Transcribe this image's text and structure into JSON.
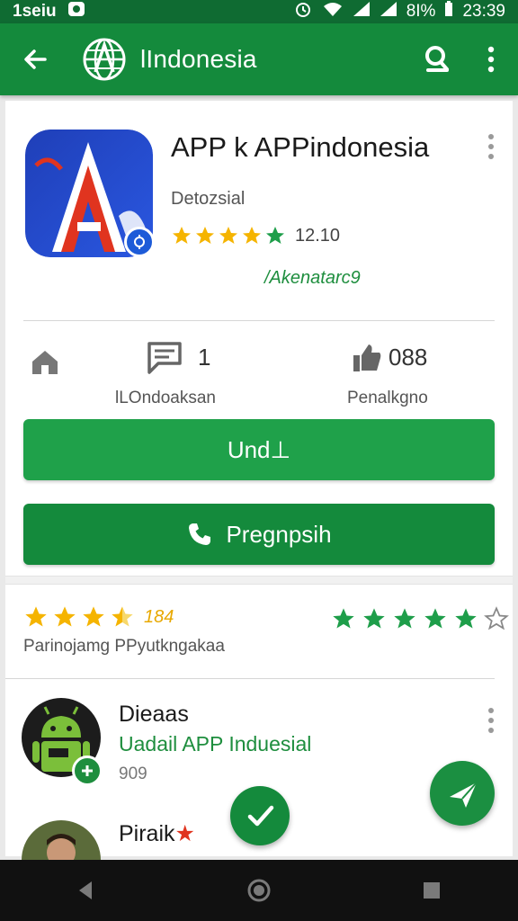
{
  "status_bar": {
    "left_text": "1seiu",
    "time": "23:39",
    "battery": "8I%"
  },
  "app_bar": {
    "title": "lIndonesia",
    "back_icon": "arrow-back-icon",
    "logo_icon": "globe-logo-icon",
    "search_icon": "search-icon",
    "more_icon": "more-vert-icon"
  },
  "app": {
    "name": "APP k APPindonesia",
    "developer": "Detozsial",
    "rating": "12.10",
    "category": "/Akenatarc9",
    "stars_filled": 5
  },
  "stats": {
    "home_icon": "home-icon",
    "messages_count": "1",
    "messages_label": "lLOndoaksan",
    "likes_count": "088",
    "likes_label": "Penalkgno"
  },
  "buttons": {
    "update_label": "Und⊥",
    "call_label": "Pregnpsih"
  },
  "ratings": {
    "score": "184",
    "caption": "Parinojamg PPyutkngakaa",
    "gold_stars": 3.5,
    "green_stars": 5,
    "total_green_stars": 6
  },
  "reviews": [
    {
      "name": "Dieaas",
      "text": "Uadail APP Induesial",
      "meta": "909"
    },
    {
      "name": "Piraik",
      "text": "",
      "meta": ""
    }
  ],
  "colors": {
    "primary": "#148a3c",
    "accent": "#1fa14a",
    "status": "#0f6b32",
    "star_gold": "#f5b400"
  }
}
